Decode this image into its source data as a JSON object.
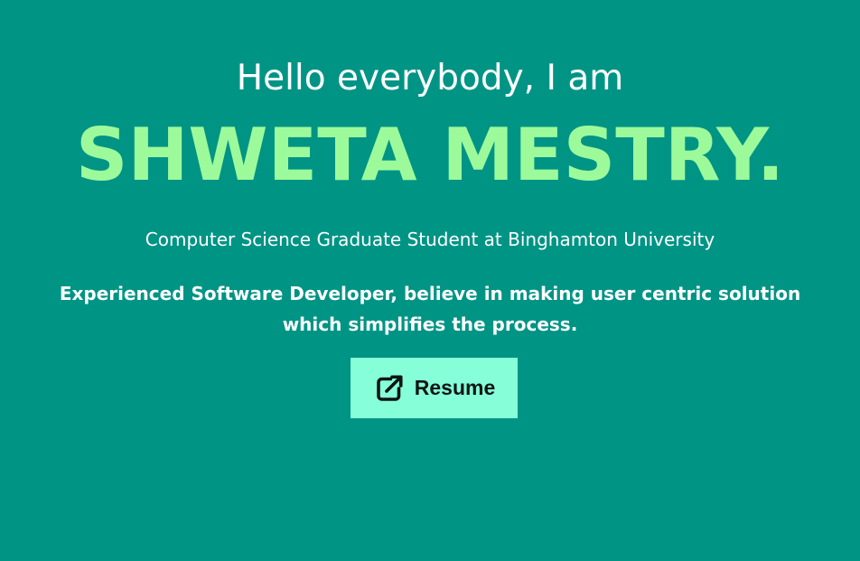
{
  "hero": {
    "greeting": "Hello everybody, I am",
    "name": "SHWETA MESTRY.",
    "subtitle": "Computer Science Graduate Student at Binghamton University",
    "tagline": "Experienced Software Developer, believe in making user centric solution which simplifies the process.",
    "resume_button": {
      "label": "Resume",
      "icon": "external-link-icon"
    }
  },
  "colors": {
    "background": "#009485",
    "name": "#9dfa9b",
    "text": "#ffffff",
    "button": "#86ffd8",
    "button_text": "#0c1512"
  }
}
